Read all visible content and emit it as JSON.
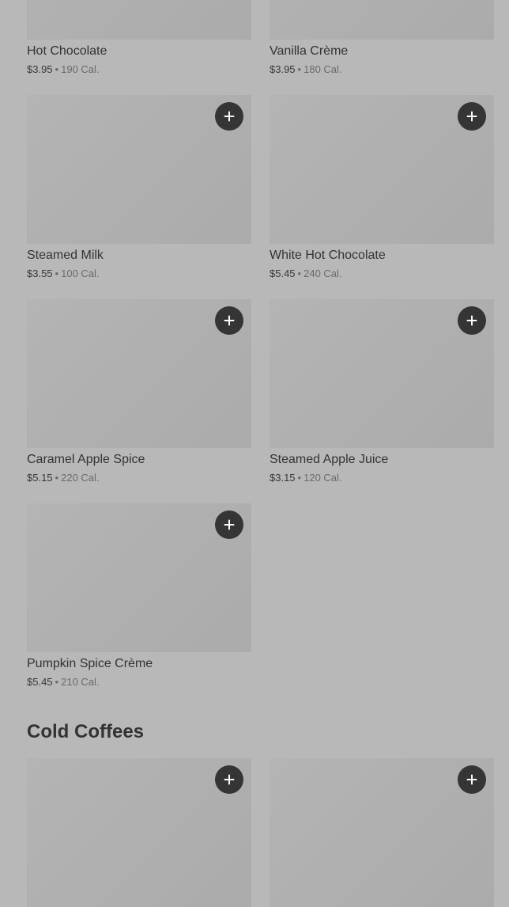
{
  "items": [
    {
      "name": "Hot Chocolate",
      "price": "$3.95",
      "separator": "•",
      "calories": "190 Cal.",
      "add_icon": "plus-icon"
    },
    {
      "name": "Vanilla Crème",
      "price": "$3.95",
      "separator": "•",
      "calories": "180 Cal.",
      "add_icon": "plus-icon"
    },
    {
      "name": "Steamed Milk",
      "price": "$3.55",
      "separator": "•",
      "calories": "100 Cal.",
      "add_icon": "plus-icon"
    },
    {
      "name": "White Hot Chocolate",
      "price": "$5.45",
      "separator": "•",
      "calories": "240 Cal.",
      "add_icon": "plus-icon"
    },
    {
      "name": "Caramel Apple Spice",
      "price": "$5.15",
      "separator": "•",
      "calories": "220 Cal.",
      "add_icon": "plus-icon"
    },
    {
      "name": "Steamed Apple Juice",
      "price": "$3.15",
      "separator": "•",
      "calories": "120 Cal.",
      "add_icon": "plus-icon"
    },
    {
      "name": "Pumpkin Spice Crème",
      "price": "$5.45",
      "separator": "•",
      "calories": "210 Cal.",
      "add_icon": "plus-icon"
    }
  ],
  "sections": [
    {
      "title": "Cold Coffees"
    }
  ],
  "colors": {
    "overlay_background": "#b8b8b8",
    "image_placeholder": "#afafaf",
    "add_button": "#353535",
    "text_primary": "#333333",
    "text_secondary": "#6a6a6a"
  }
}
